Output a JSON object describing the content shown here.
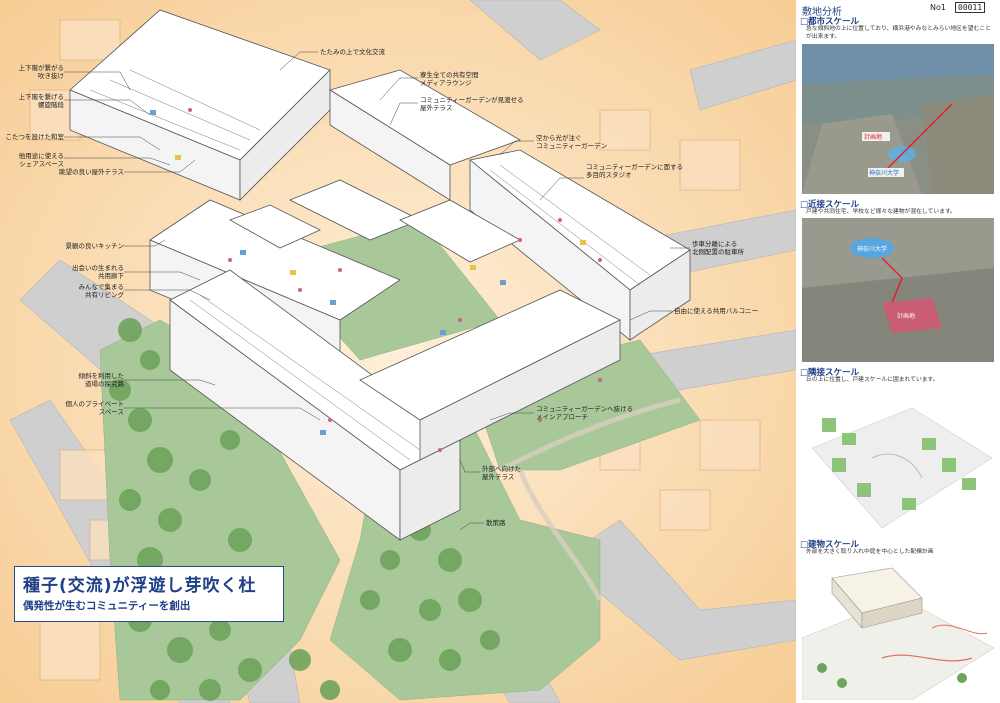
{
  "title": {
    "main": "種子(交流)が浮遊し芽吹く杜",
    "sub": "偶発性が生むコミュニティーを創出"
  },
  "labels_left": [
    {
      "text": "上下階が繋がる\n吹き抜け"
    },
    {
      "text": "上下階を繋げる\n螺旋階段"
    },
    {
      "text": "こたつを設けた和室"
    },
    {
      "text": "他用途に使える\nシェアスペース"
    },
    {
      "text": "眺望の良い屋外テラス"
    },
    {
      "text": "景観の良いキッチン"
    },
    {
      "text": "出会いの生まれる\n共用廊下"
    },
    {
      "text": "みんなで集まる\n共有リビング"
    },
    {
      "text": "傾斜を利用した\n道場の探究路"
    },
    {
      "text": "個人のプライベート\nスペース"
    }
  ],
  "labels_right": [
    {
      "text": "たたみの上で文化交流"
    },
    {
      "text": "寮生全ての共有空間\nメディアラウンジ"
    },
    {
      "text": "コミュニティーガーデンが見渡せる\n屋外テラス"
    },
    {
      "text": "空から光が注ぐ\nコミュニティーガーデン"
    },
    {
      "text": "コミュニティーガーデンに面する\n多目的スタジオ"
    },
    {
      "text": "歩車分離による\n北側配置の駐車所"
    },
    {
      "text": "自由に使える共用バルコニー"
    },
    {
      "text": "コミュニティーガーデンへ抜ける\nメインアプローチ"
    },
    {
      "text": "外部へ向けた\n屋外テラス"
    },
    {
      "text": "散策路"
    }
  ],
  "panel": {
    "header": "敷地分析",
    "sheet_no": "No1",
    "sheet_code": "00011",
    "sections": [
      {
        "title": "□都市スケール",
        "desc": "急な傾斜地の上に位置しており、横浜港やみなとみらい地区を望むことが出来ます。"
      },
      {
        "title": "□近接スケール",
        "desc": "戸建や共同住宅、学校など様々な建物が混在しています。"
      },
      {
        "title": "□隣接スケール",
        "desc": "丘の上に位置し、戸建スケールに囲まれています。"
      },
      {
        "title": "□建物スケール",
        "desc": "外部を大きく取り入れ中庭を中心とした配棟計画"
      }
    ],
    "map_labels": [
      "計画地",
      "神奈川大学"
    ],
    "map2_labels": [
      "神奈川大学",
      "計画地"
    ]
  },
  "colors": {
    "accent": "#1f3f86",
    "background_wash": "#f6c98a",
    "road": "#c9c9c9",
    "tree": "#7fb06a",
    "building": "#ffffff"
  }
}
